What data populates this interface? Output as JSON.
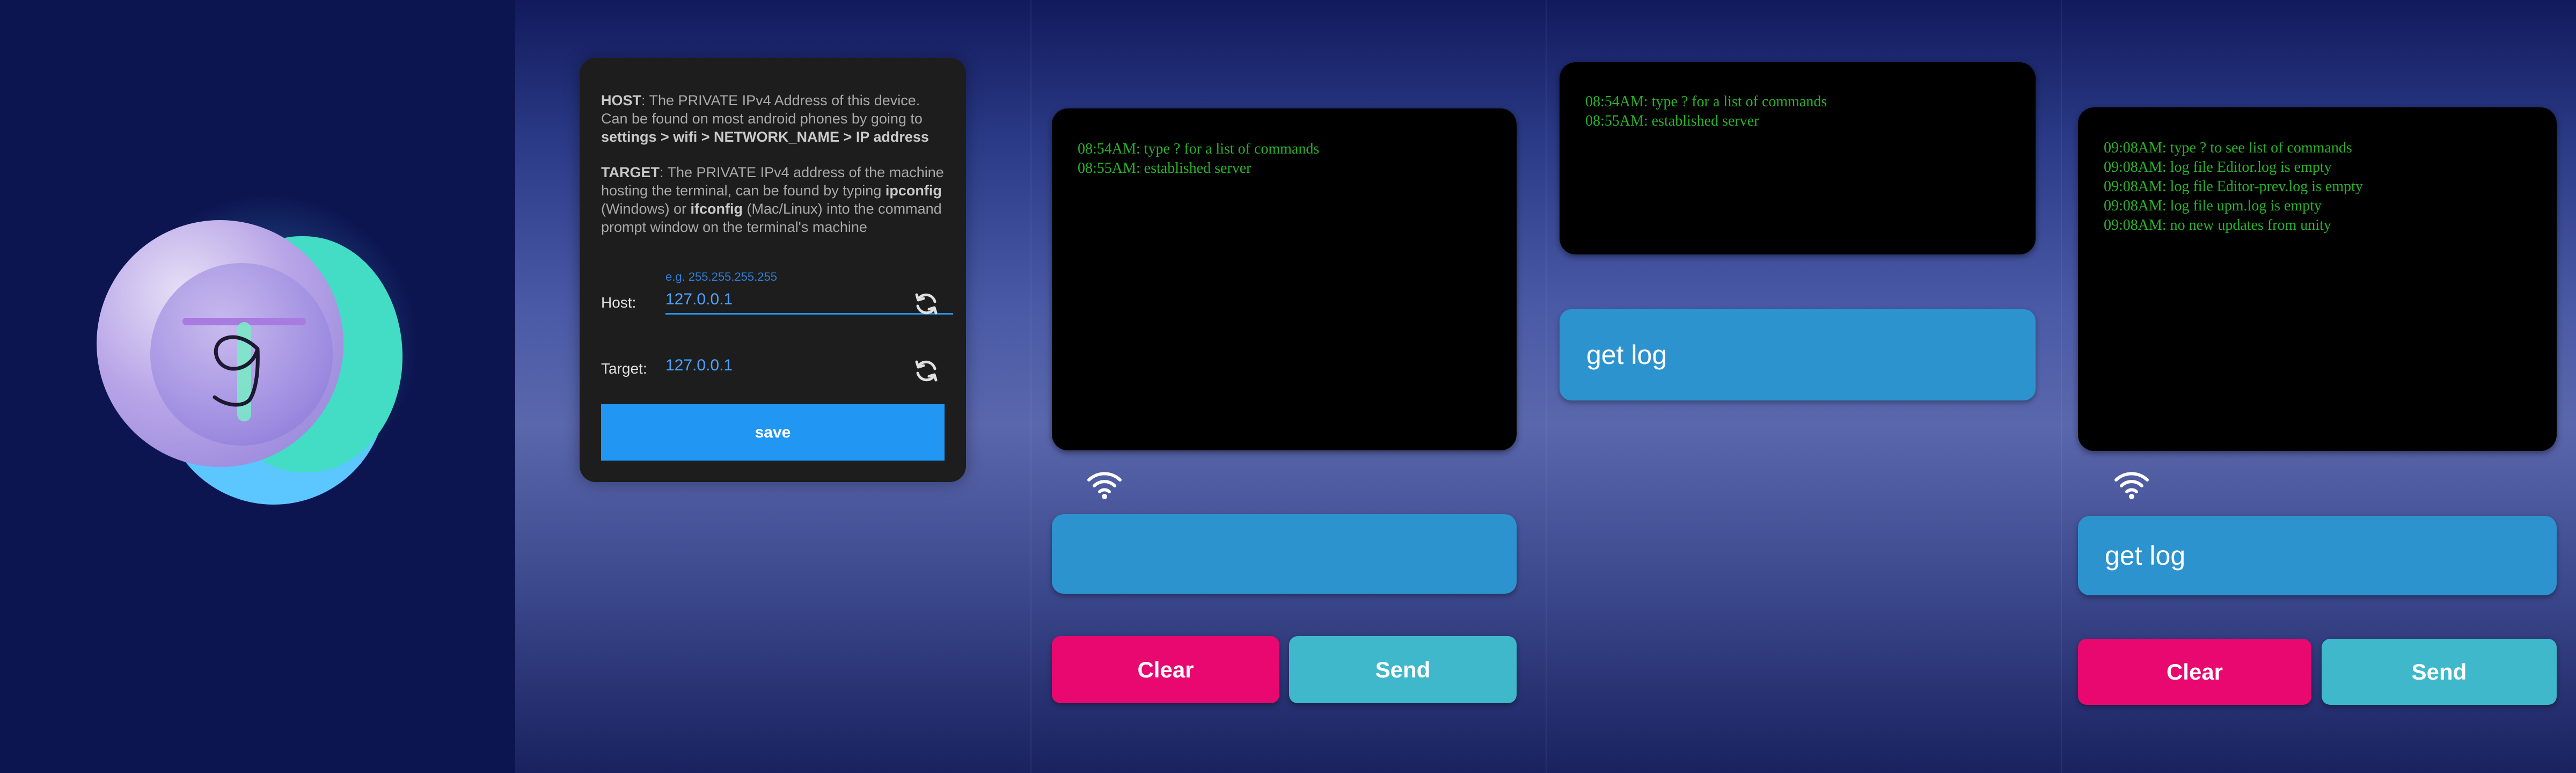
{
  "settings": {
    "host_help": {
      "term": "HOST",
      "text": ": The PRIVATE IPv4 Address of this device. Can be found on most android phones by going to",
      "path": "settings > wifi > NETWORK_NAME > IP address"
    },
    "target_help": {
      "term": "TARGET",
      "text1": ": The PRIVATE IPv4 address of the machine hosting the terminal, can be found by typing",
      "cmd1": "ipconfig",
      "text2": "(Windows) or",
      "cmd2": "ifconfig",
      "text3": "(Mac/Linux) into the command prompt window on the terminal's machine"
    },
    "host_label": "Host:",
    "host_placeholder": "e.g. 255.255.255.255",
    "host_value": "127.0.0.1",
    "target_label": "Target:",
    "target_value": "127.0.0.1",
    "save_label": "save"
  },
  "console_a": {
    "lines": [
      "08:54AM: type ? for a list of commands",
      "08:55AM: established server"
    ],
    "input_value": "",
    "clear_label": "Clear",
    "send_label": "Send"
  },
  "console_b": {
    "lines": [
      "08:54AM: type ? for a list of commands",
      "08:55AM: established server"
    ],
    "input_value": "get log"
  },
  "console_c": {
    "lines": [
      "09:08AM: type ? to see list of commands",
      "09:08AM: log file Editor.log is empty",
      "09:08AM: log file Editor-prev.log is empty",
      "09:08AM: log file upm.log is empty",
      "09:08AM: no new updates from unity"
    ],
    "input_value": "get log",
    "clear_label": "Clear",
    "send_label": "Send"
  },
  "colors": {
    "accent_blue": "#2196f3",
    "console_green": "#27b327",
    "input_blue": "#2c93cf",
    "clear_pink": "#e8086f",
    "send_teal": "#3fb8cb"
  },
  "icons": [
    "app-logo-icon",
    "refresh-icon",
    "wifi-icon"
  ]
}
